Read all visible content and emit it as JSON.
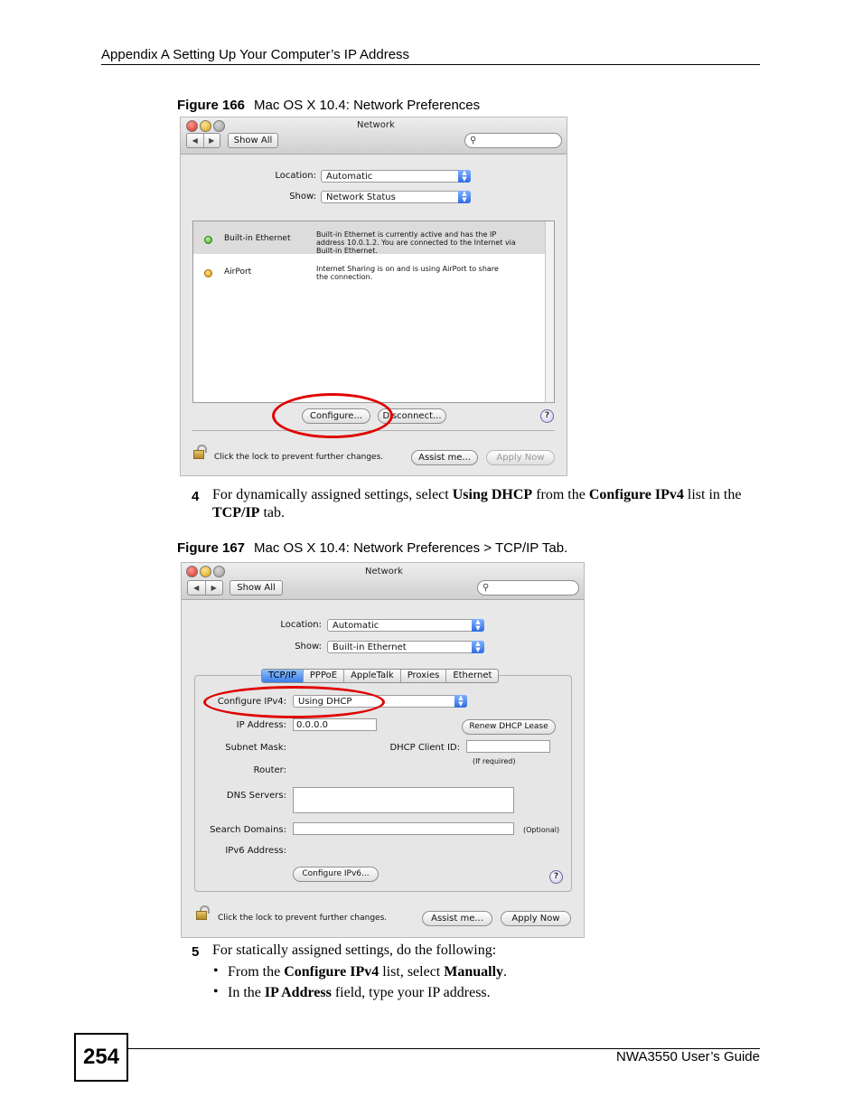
{
  "header": {
    "running_title": "Appendix A Setting Up Your Computer’s IP Address"
  },
  "figure166": {
    "label": "Figure 166",
    "title": "Mac OS X 10.4: Network Preferences",
    "window": {
      "title": "Network",
      "nav_back": "◀",
      "nav_fwd": "▶",
      "show_all": "Show All",
      "location_label": "Location:",
      "location_value": "Automatic",
      "show_label": "Show:",
      "show_value": "Network Status",
      "rows": [
        {
          "name": "Built-in Ethernet",
          "status": "Built-in Ethernet is currently active and has the IP address 10.0.1.2. You are connected to the Internet via Built-in Ethernet.",
          "color": "#35a81a"
        },
        {
          "name": "AirPort",
          "status": "Internet Sharing is on and is using AirPort to share the connection.",
          "color": "#e49a00"
        }
      ],
      "configure": "Configure...",
      "disconnect": "Disconnect...",
      "help": "?",
      "lock_text": "Click the lock to prevent further changes.",
      "assist": "Assist me...",
      "apply": "Apply Now"
    }
  },
  "step4": {
    "num": "4",
    "t1": "For dynamically assigned settings, select ",
    "b1": "Using DHCP",
    "t2": " from the ",
    "b2": "Configure IPv4",
    "t3": " list in the ",
    "b3": "TCP/IP",
    "t4": " tab."
  },
  "figure167": {
    "label": "Figure 167",
    "title": "Mac OS X 10.4: Network Preferences > TCP/IP Tab.",
    "window": {
      "title": "Network",
      "show_all": "Show All",
      "location_label": "Location:",
      "location_value": "Automatic",
      "show_label": "Show:",
      "show_value": "Built-in Ethernet",
      "tabs": [
        "TCP/IP",
        "PPPoE",
        "AppleTalk",
        "Proxies",
        "Ethernet"
      ],
      "configure_ipv4_label": "Configure IPv4:",
      "configure_ipv4_value": "Using DHCP",
      "ip_label": "IP Address:",
      "ip_value": "0.0.0.0",
      "renew": "Renew DHCP Lease",
      "subnet_label": "Subnet Mask:",
      "dhcp_client_label": "DHCP Client ID:",
      "if_required": "(If required)",
      "router_label": "Router:",
      "dns_label": "DNS Servers:",
      "search_label": "Search Domains:",
      "optional": "(Optional)",
      "ipv6_label": "IPv6 Address:",
      "configure_ipv6": "Configure IPv6...",
      "help": "?",
      "lock_text": "Click the lock to prevent further changes.",
      "assist": "Assist me...",
      "apply": "Apply Now"
    }
  },
  "step5": {
    "num": "5",
    "text": "For statically assigned settings, do the following:",
    "bullets": [
      {
        "t1": "From the ",
        "b1": "Configure IPv4",
        "t2": " list, select ",
        "b2": "Manually",
        "t3": "."
      },
      {
        "t1": "In the ",
        "b1": "IP Address",
        "t2": " field, type your IP address.",
        "b2": "",
        "t3": ""
      }
    ]
  },
  "footer": {
    "page_number": "254",
    "guide": "NWA3550 User’s Guide"
  }
}
